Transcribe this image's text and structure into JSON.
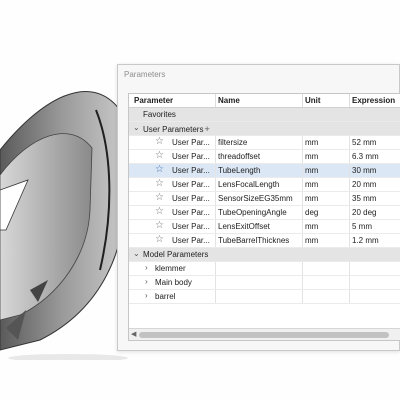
{
  "dialog": {
    "title": "Parameters"
  },
  "columns": {
    "parameter": "Parameter",
    "name": "Name",
    "unit": "Unit",
    "expression": "Expression"
  },
  "groups": {
    "favorites": "Favorites",
    "user_parameters": "User Parameters",
    "model_parameters": "Model Parameters"
  },
  "user_rows": [
    {
      "param": "User Par...",
      "name": "filtersize",
      "unit": "mm",
      "expression": "52 mm",
      "selected": false
    },
    {
      "param": "User Par...",
      "name": "threadoffset",
      "unit": "mm",
      "expression": "6.3 mm",
      "selected": false
    },
    {
      "param": "User Par...",
      "name": "TubeLength",
      "unit": "mm",
      "expression": "30 mm",
      "selected": true
    },
    {
      "param": "User Par...",
      "name": "LensFocalLength",
      "unit": "mm",
      "expression": "20 mm",
      "selected": false
    },
    {
      "param": "User Par...",
      "name": "SensorSizeEG35mm",
      "unit": "mm",
      "expression": "35 mm",
      "selected": false
    },
    {
      "param": "User Par...",
      "name": "TubeOpeningAngle",
      "unit": "deg",
      "expression": "20 deg",
      "selected": false
    },
    {
      "param": "User Par...",
      "name": "LensExitOffset",
      "unit": "mm",
      "expression": "5 mm",
      "selected": false
    },
    {
      "param": "User Par...",
      "name": "TubeBarrelThicknes",
      "unit": "mm",
      "expression": "1.2 mm",
      "selected": false
    }
  ],
  "model_rows": [
    {
      "label": "klemmer"
    },
    {
      "label": "Main body"
    },
    {
      "label": "barrel"
    }
  ],
  "icons": {
    "star": "star-icon",
    "expand": "chevron-down-icon",
    "collapse": "chevron-right-icon",
    "add": "plus-icon"
  },
  "colors": {
    "selected_row": "#dbe7f5",
    "group_row": "#e4e4e4",
    "star_selected": "#3a6fb0"
  }
}
